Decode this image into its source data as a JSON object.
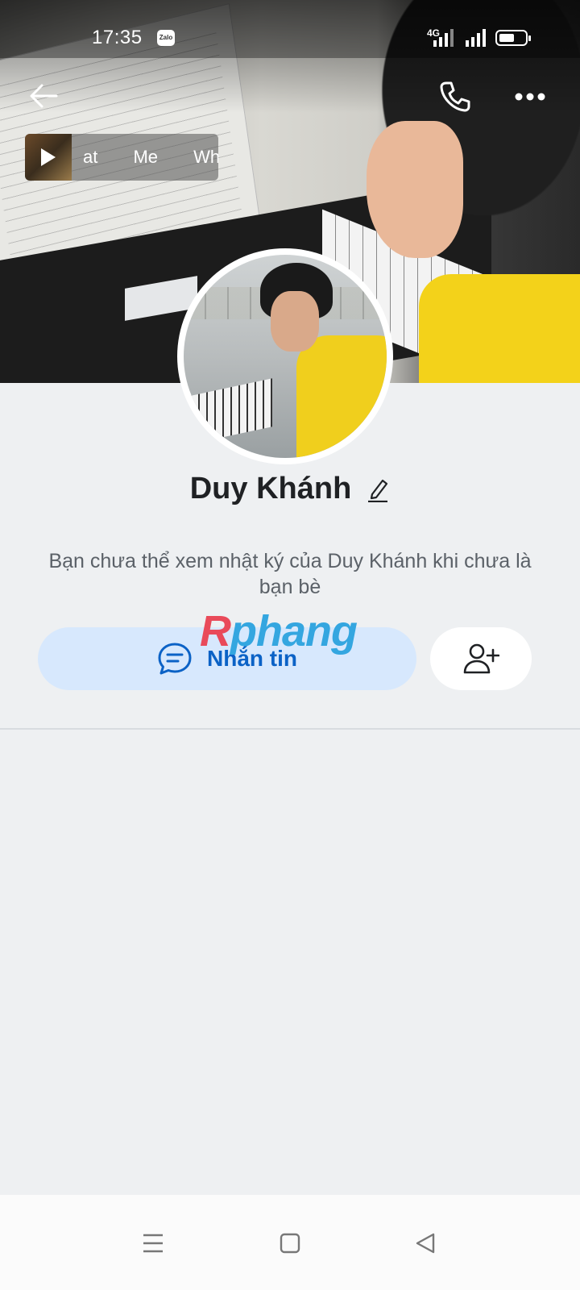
{
  "status_bar": {
    "time": "17:35",
    "app_badge": "Zalo",
    "network": "4G",
    "battery_icon": "battery-icon"
  },
  "header": {
    "back_icon": "arrow-left-icon",
    "call_icon": "phone-icon",
    "more_icon": "more-horizontal-icon"
  },
  "music": {
    "track_text": "at Me Whe",
    "play_icon": "play-icon"
  },
  "profile": {
    "name": "Duy Khánh",
    "edit_icon": "pencil-icon",
    "notice": "Bạn chưa thể xem nhật ký của Duy Khánh khi chưa là bạn bè"
  },
  "actions": {
    "message_label": "Nhắn tin",
    "message_icon": "chat-bubble-icon",
    "add_friend_icon": "add-user-icon"
  },
  "watermark": {
    "part1": "R",
    "part2": "phang"
  },
  "colors": {
    "primary": "#0b62c6",
    "message_bg": "#d7e8fd",
    "page_bg": "#eef0f2"
  },
  "navbar": {
    "menu_icon": "menu-icon",
    "home_icon": "square-home-icon",
    "back_icon": "triangle-back-icon"
  }
}
